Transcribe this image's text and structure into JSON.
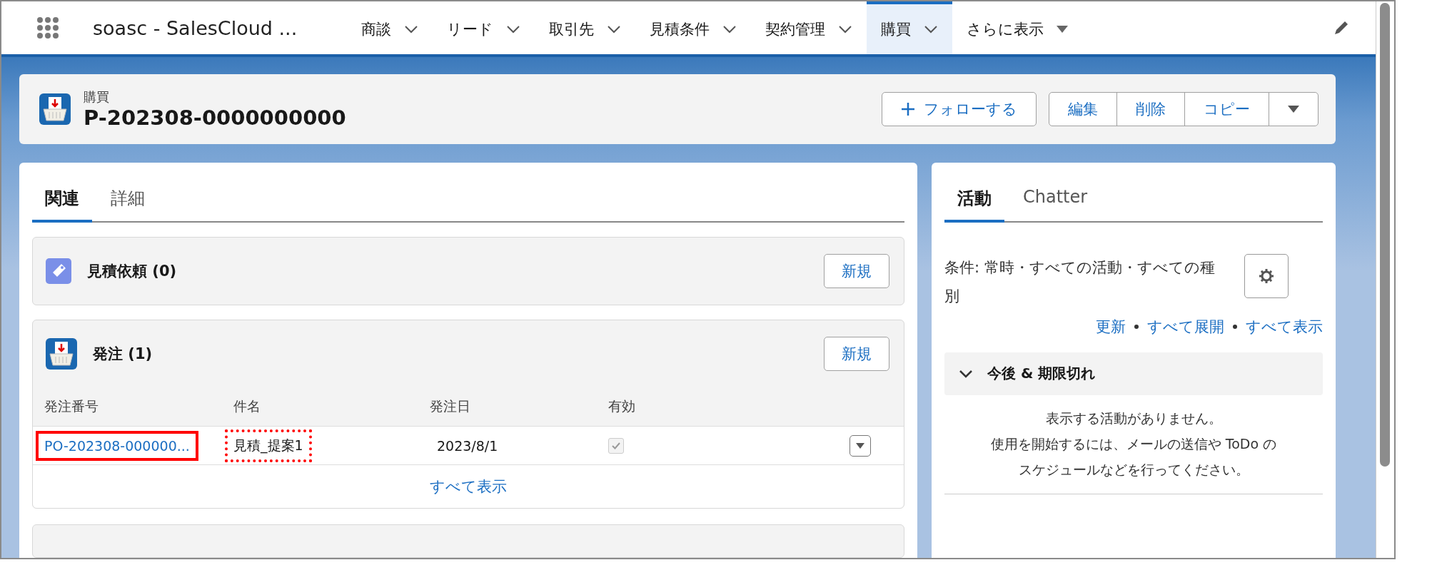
{
  "nav": {
    "app_title": "soasc - SalesCloud ...",
    "more": "さらに表示",
    "tabs": [
      {
        "label": "商談",
        "selected": false
      },
      {
        "label": "リード",
        "selected": false
      },
      {
        "label": "取引先",
        "selected": false
      },
      {
        "label": "見積条件",
        "selected": false
      },
      {
        "label": "契約管理",
        "selected": false
      },
      {
        "label": "購買",
        "selected": true
      }
    ]
  },
  "record": {
    "object_label": "購買",
    "name": "P-202308-0000000000",
    "follow": "フォローする",
    "actions": [
      "編集",
      "削除",
      "コピー"
    ]
  },
  "left_tabs": [
    {
      "label": "関連",
      "selected": true
    },
    {
      "label": "詳細",
      "selected": false
    }
  ],
  "related_lists": [
    {
      "kind": "quote",
      "title": "見積依頼 (0)",
      "new_button": "新規"
    },
    {
      "kind": "purchase",
      "title": "発注 (1)",
      "new_button": "新規",
      "columns": [
        "発注番号",
        "件名",
        "発注日",
        "有効"
      ],
      "rows": [
        {
          "cells": [
            {
              "text": "PO-202308-000000...",
              "link": true,
              "marked": true,
              "dotted": false
            },
            {
              "text": "見積_提案1",
              "link": false,
              "marked": true,
              "dotted": true
            },
            {
              "text": "2023/8/1",
              "link": false,
              "marked": false
            }
          ],
          "active": true
        }
      ],
      "view_all": "すべて表示"
    }
  ],
  "activity": {
    "tabs": [
      {
        "label": "活動",
        "selected": true
      },
      {
        "label": "Chatter",
        "selected": false
      }
    ],
    "filter": "条件: 常時・すべての活動・すべての種別",
    "links": [
      "更新",
      "すべて展開",
      "すべて表示"
    ],
    "section": {
      "title": "今後 & 期限切れ",
      "expanded": true
    },
    "empty_message": [
      "表示する活動がありません。",
      "使用を開始するには、メールの送信や ToDo の",
      "スケジュールなどを行ってください。"
    ]
  }
}
